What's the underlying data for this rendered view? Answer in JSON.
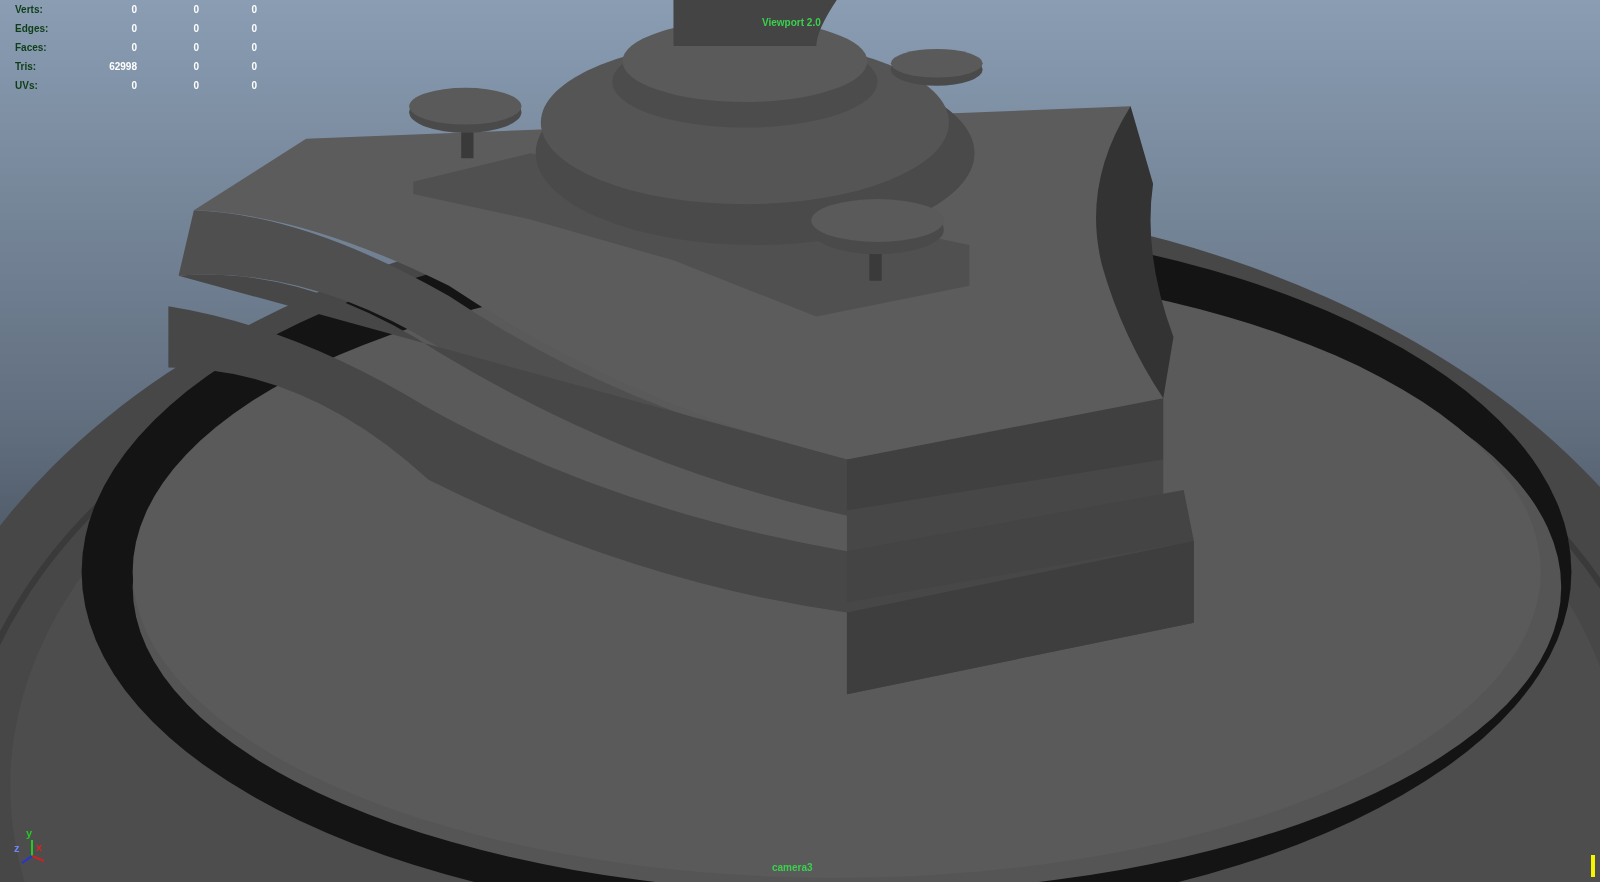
{
  "hud_stats": [
    {
      "label": "Verts:",
      "values": [
        "0",
        "0",
        "0"
      ]
    },
    {
      "label": "Edges:",
      "values": [
        "0",
        "0",
        "0"
      ]
    },
    {
      "label": "Faces:",
      "values": [
        "0",
        "0",
        "0"
      ]
    },
    {
      "label": "Tris:",
      "values": [
        "62998",
        "0",
        "0"
      ]
    },
    {
      "label": "UVs:",
      "values": [
        "0",
        "0",
        "0"
      ]
    }
  ],
  "renderer_label": "Viewport 2.0",
  "axis_gizmo": {
    "x_label": "x",
    "y_label": "y",
    "z_label": "z"
  },
  "camera_label": "camera3"
}
